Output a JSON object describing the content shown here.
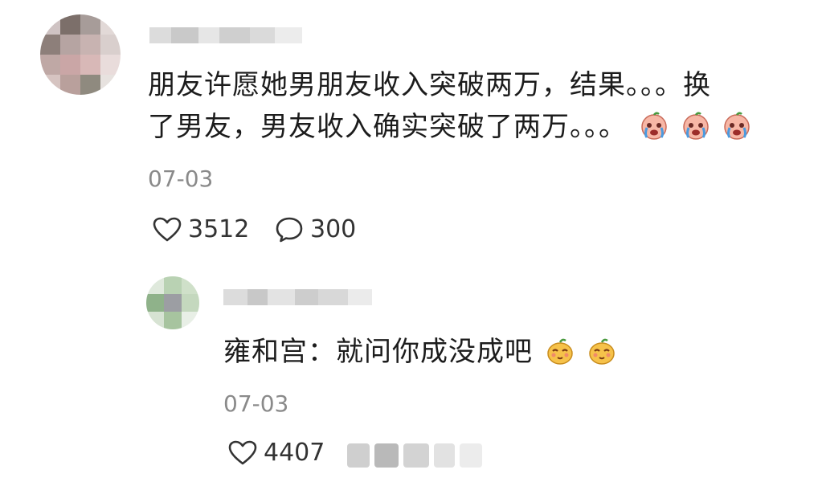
{
  "comment": {
    "text_line1": "朋友许愿她男朋友收入突破两万，结果。。。换",
    "text_line2": "了男友，男友收入确实突破了两万。。。",
    "date": "07-03",
    "likes": "3512",
    "replies": "300",
    "emojis": [
      "crying-emoji",
      "crying-emoji",
      "crying-emoji"
    ]
  },
  "reply": {
    "text": "雍和宫：就问你成没成吧",
    "date": "07-03",
    "likes": "4407",
    "emojis": [
      "smirk-emoji",
      "smirk-emoji"
    ]
  },
  "colors": {
    "text": "#1c1c1c",
    "meta": "#8a8a8a",
    "action": "#333333",
    "background": "#ffffff"
  },
  "icons": {
    "like": "heart-outline-icon",
    "reply": "speech-bubble-icon"
  }
}
